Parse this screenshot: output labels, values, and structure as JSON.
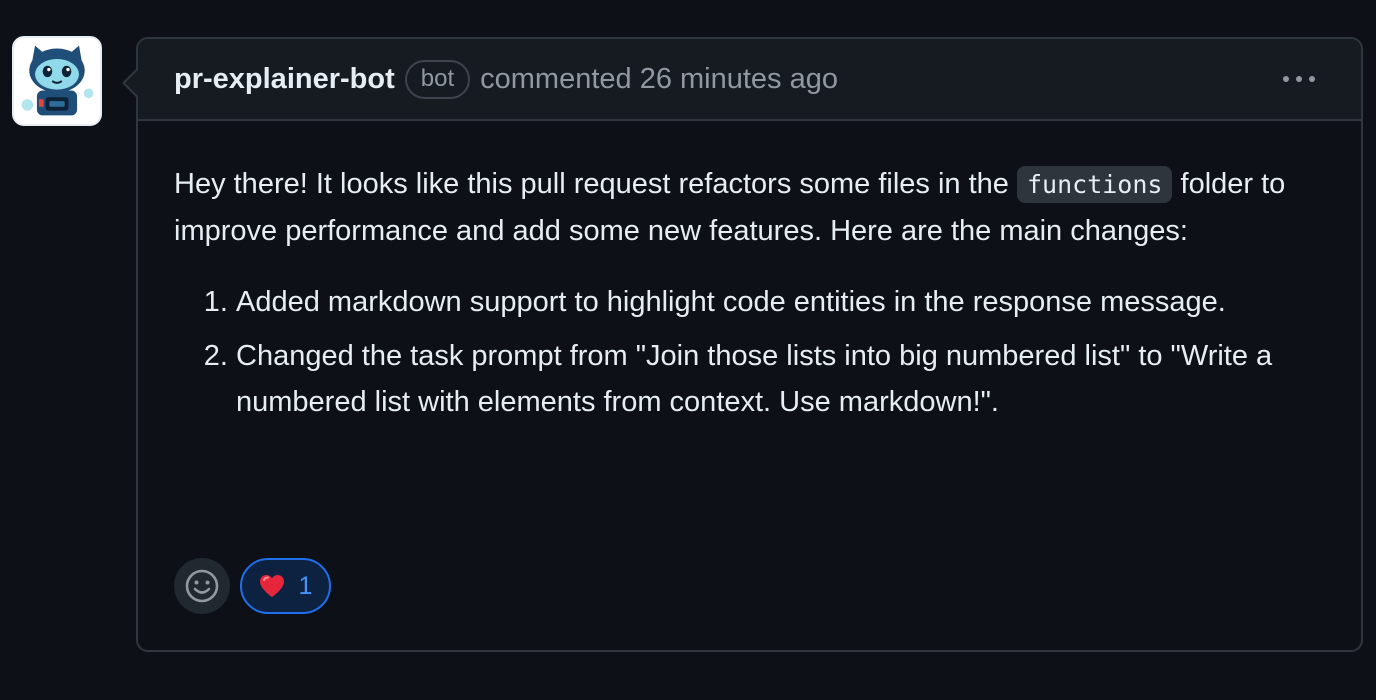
{
  "comment": {
    "author": "bot",
    "author_name": "pr-explainer-bot",
    "badge": "bot",
    "meta": "commented 26 minutes ago",
    "menu_icon": "kebab-horizontal-icon"
  },
  "body": {
    "intro_before_code": "Hey there! It looks like this pull request refactors some files in the ",
    "code": "functions",
    "intro_after_code": " folder to improve performance and add some new features. Here are the main changes:",
    "changes": [
      "Added markdown support to highlight code entities in the response message.",
      "Changed the task prompt from \"Join those lists into big numbered list\" to \"Write a numbered list with elements from context. Use markdown!\"."
    ]
  },
  "reactions": {
    "picker_icon": "smiley-icon",
    "items": [
      {
        "emoji": "❤️",
        "count": "1",
        "icon": "heart-icon"
      }
    ]
  },
  "colors": {
    "page_bg": "#0d1117",
    "header_bg": "#161b22",
    "border": "#30363d",
    "text": "#e6edf3",
    "muted": "#9198a1",
    "accent": "#1f6feb",
    "heart": "#e5263b"
  }
}
